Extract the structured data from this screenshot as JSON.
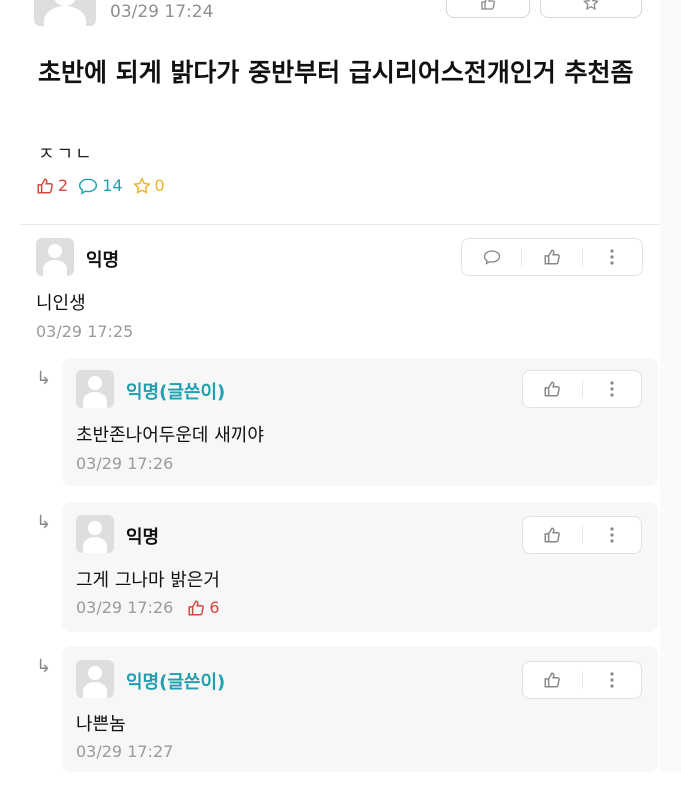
{
  "post": {
    "time": "03/29 17:24",
    "title": "초반에 되게 밝다가 중반부터 급시리어스전개인거 추천좀",
    "body": "ㅈㄱㄴ",
    "stats": {
      "likes": "2",
      "comments": "14",
      "scraps": "0"
    }
  },
  "comments": [
    {
      "author": "익명",
      "text": "니인생",
      "time": "03/29 17:25"
    }
  ],
  "replies": [
    {
      "author": "익명(글쓴이)",
      "text": "초반존나어두운데 새끼야",
      "time": "03/29 17:26",
      "votes": ""
    },
    {
      "author": "익명",
      "text": "그게 그나마 밝은거",
      "time": "03/29 17:26",
      "votes": "6"
    },
    {
      "author": "익명(글쓴이)",
      "text": "나쁜놈",
      "time": "03/29 17:27",
      "votes": ""
    }
  ],
  "colors": {
    "like": "#d4473f",
    "comment": "#1f9fb0",
    "scrap": "#e9b52a",
    "writer": "#1f9fb0"
  },
  "icons": [
    "thumbs-up-icon",
    "speech-bubble-icon",
    "star-icon",
    "more-vertical-icon",
    "reply-arrow-icon"
  ]
}
